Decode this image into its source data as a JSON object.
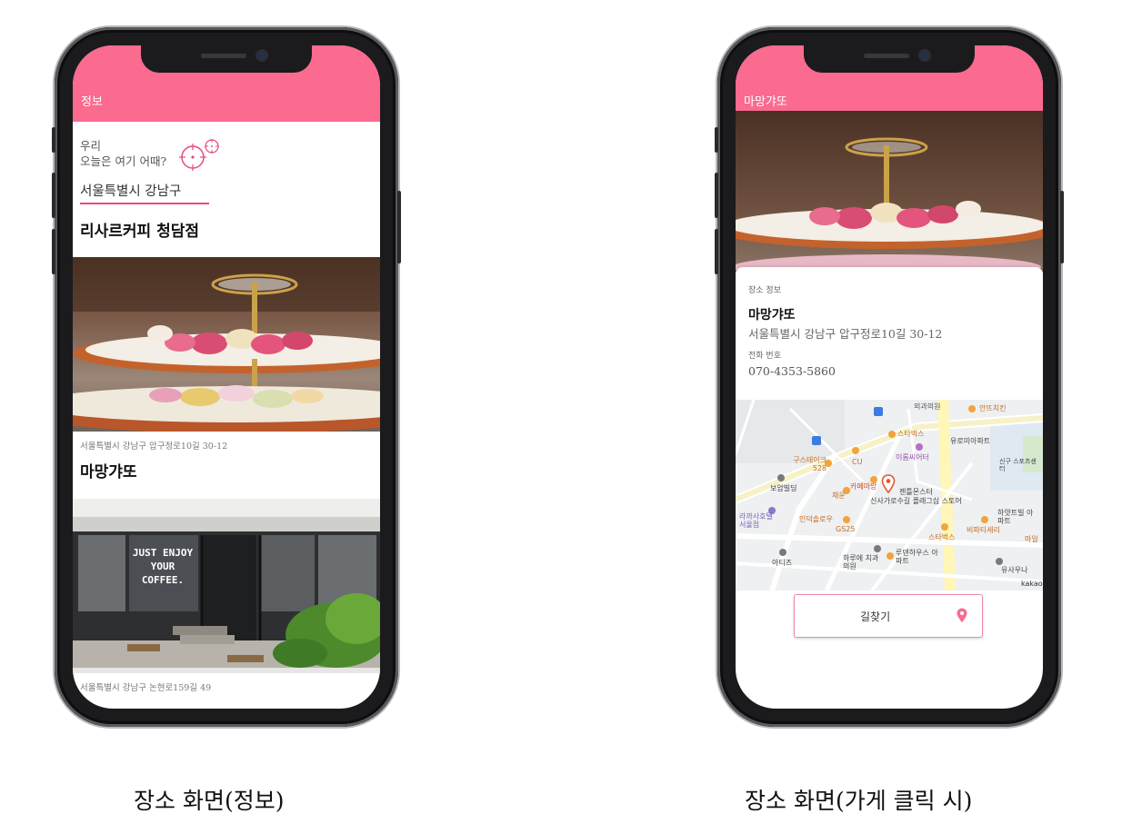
{
  "left_phone": {
    "appbar_title": "정보",
    "greeting_line1": "우리",
    "greeting_line2": "오늘은 여기 어때?",
    "location": "서울특별시 강남구",
    "cards": [
      {
        "title": "리사르커피 청담점",
        "address": ""
      },
      {
        "address": "서울특별시 강남구 압구정로10길 30-12",
        "title": "마망갸또"
      },
      {
        "address": "서울특별시 강남구 논현로159길 49",
        "title": ""
      }
    ],
    "cafe_sign": "JUST ENJOY YOUR COFFEE."
  },
  "right_phone": {
    "appbar_title": "마망갸또",
    "section_label": "장소 정보",
    "place_name": "마망갸또",
    "place_address": "서울특별시 강남구 압구정로10길 30-12",
    "phone_label": "전화 번호",
    "phone_number": "070-4353-5860",
    "directions_button": "길찾기",
    "map_labels": [
      "외과의원",
      "스타벅스",
      "유로미아파트",
      "이롬씨어터",
      "구스테이크 528",
      "CU",
      "보암빌딩",
      "카페마망",
      "젠틀몬스터",
      "신사가로수길 플래그십 스토어",
      "채운",
      "라까사호텔 서울점",
      "인덕솔로우",
      "GS25",
      "스타벅스",
      "비파티세리",
      "하얏트빌 아파트",
      "아티즈",
      "하루에 치과의원",
      "루덴하우스 아파트",
      "유사우나",
      "안뜨치킨",
      "신구 스포츠센터",
      "마일",
      "kakao"
    ]
  },
  "captions": {
    "left": "장소 화면(정보)",
    "right": "장소 화면(가게 클릭 시)"
  },
  "colors": {
    "accent": "#fb6a8f",
    "underline": "#e64d7c"
  }
}
